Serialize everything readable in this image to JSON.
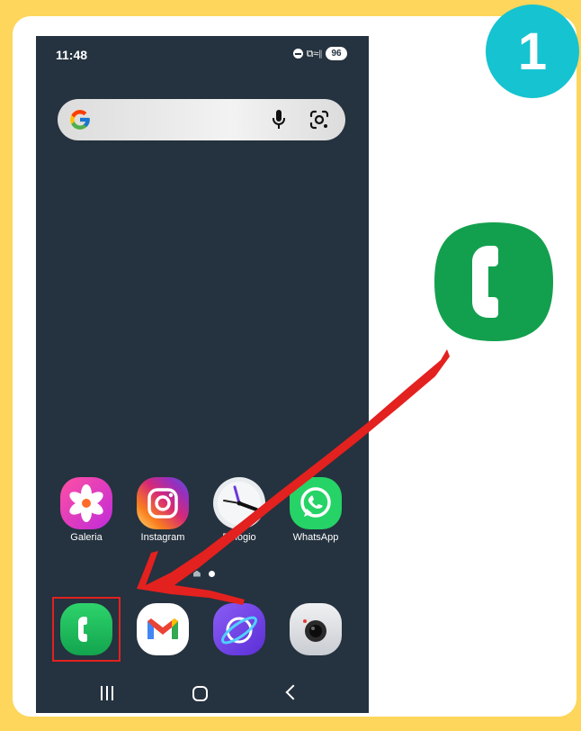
{
  "step": {
    "number": "1",
    "color": "#16C3D0"
  },
  "status_bar": {
    "time": "11:48",
    "signal_glyph": "⧉≈∥",
    "battery": "96"
  },
  "search_bar": {
    "logo": "G"
  },
  "home_apps": [
    {
      "label": "Galeria",
      "icon": "gallery-icon"
    },
    {
      "label": "Instagram",
      "icon": "instagram-icon"
    },
    {
      "label": "Relógio",
      "icon": "clock-icon"
    },
    {
      "label": "WhatsApp",
      "icon": "whatsapp-icon"
    }
  ],
  "page_indicator": {
    "lines": "="
  },
  "dock_apps": [
    {
      "icon": "phone-icon",
      "highlighted": true
    },
    {
      "icon": "gmail-icon"
    },
    {
      "icon": "internet-icon"
    },
    {
      "icon": "camera-icon"
    }
  ],
  "colors": {
    "background": "#FDD65B",
    "phone_bg": "#25323F",
    "highlight": "#E3211F",
    "arrow": "#E3211F",
    "phone_green": "#13A04E"
  }
}
